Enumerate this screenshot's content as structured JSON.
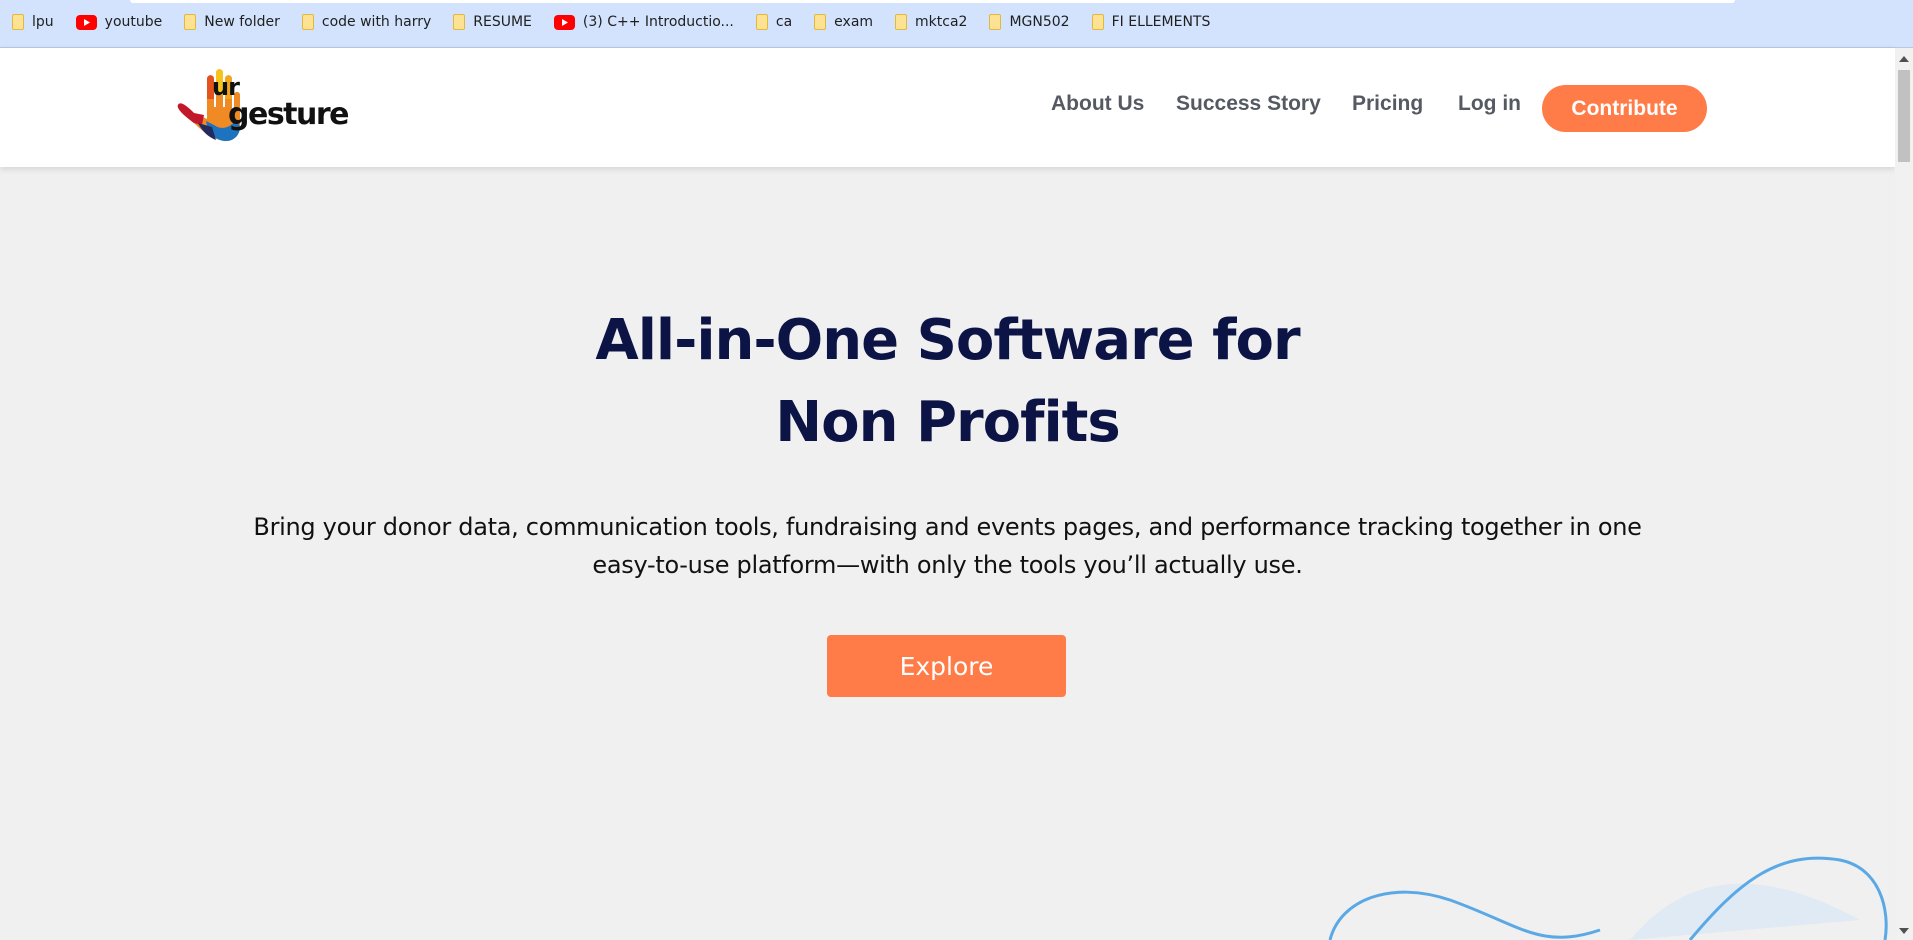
{
  "bookmarks": [
    {
      "label": "lpu",
      "icon": "folder-icon"
    },
    {
      "label": "youtube",
      "icon": "youtube-icon"
    },
    {
      "label": "New folder",
      "icon": "folder-icon"
    },
    {
      "label": "code with harry",
      "icon": "folder-icon"
    },
    {
      "label": "RESUME",
      "icon": "folder-icon"
    },
    {
      "label": "(3) C++ Introductio...",
      "icon": "youtube-icon"
    },
    {
      "label": "ca",
      "icon": "folder-icon"
    },
    {
      "label": "exam",
      "icon": "folder-icon"
    },
    {
      "label": "mktca2",
      "icon": "folder-icon"
    },
    {
      "label": "MGN502",
      "icon": "folder-icon"
    },
    {
      "label": "FI ELLEMENTS",
      "icon": "folder-icon"
    }
  ],
  "header": {
    "logo": {
      "part1": "ur",
      "part2": "gesture"
    },
    "nav": {
      "about": "About Us",
      "success": "Success Story",
      "pricing": "Pricing",
      "login": "Log in"
    },
    "contribute_label": "Contribute"
  },
  "hero": {
    "title_line1": "All-in-One Software for",
    "title_line2": "Non Profits",
    "subtitle": "Bring your donor data, communication tools, fundraising and events pages, and performance tracking together in one easy-to-use platform—with only the tools you’ll actually use.",
    "explore_label": "Explore"
  },
  "colors": {
    "accent": "#ff7b47",
    "title": "#0c1445",
    "nav_text": "#555a62",
    "bookmark_bar": "#d3e3fd",
    "wave": "#5aa9e6"
  }
}
